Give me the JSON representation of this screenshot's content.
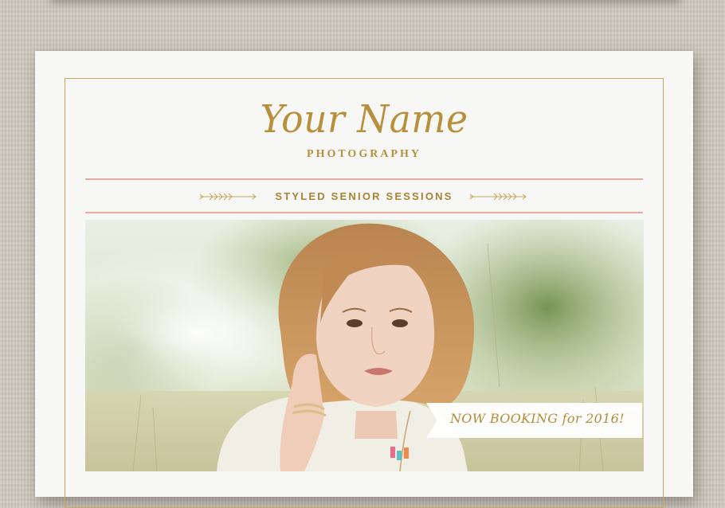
{
  "flyer": {
    "name": "Your Name",
    "subtitle": "PHOTOGRAPHY",
    "section_title": "STYLED SENIOR SESSIONS",
    "banner": "NOW BOOKING for 2016!"
  },
  "colors": {
    "gold": "#b88f3a",
    "blush": "#e5aca4",
    "paper": "#f7f7f6",
    "background": "#cfc8bd"
  },
  "icons": [
    "arrow-ornament-icon"
  ]
}
